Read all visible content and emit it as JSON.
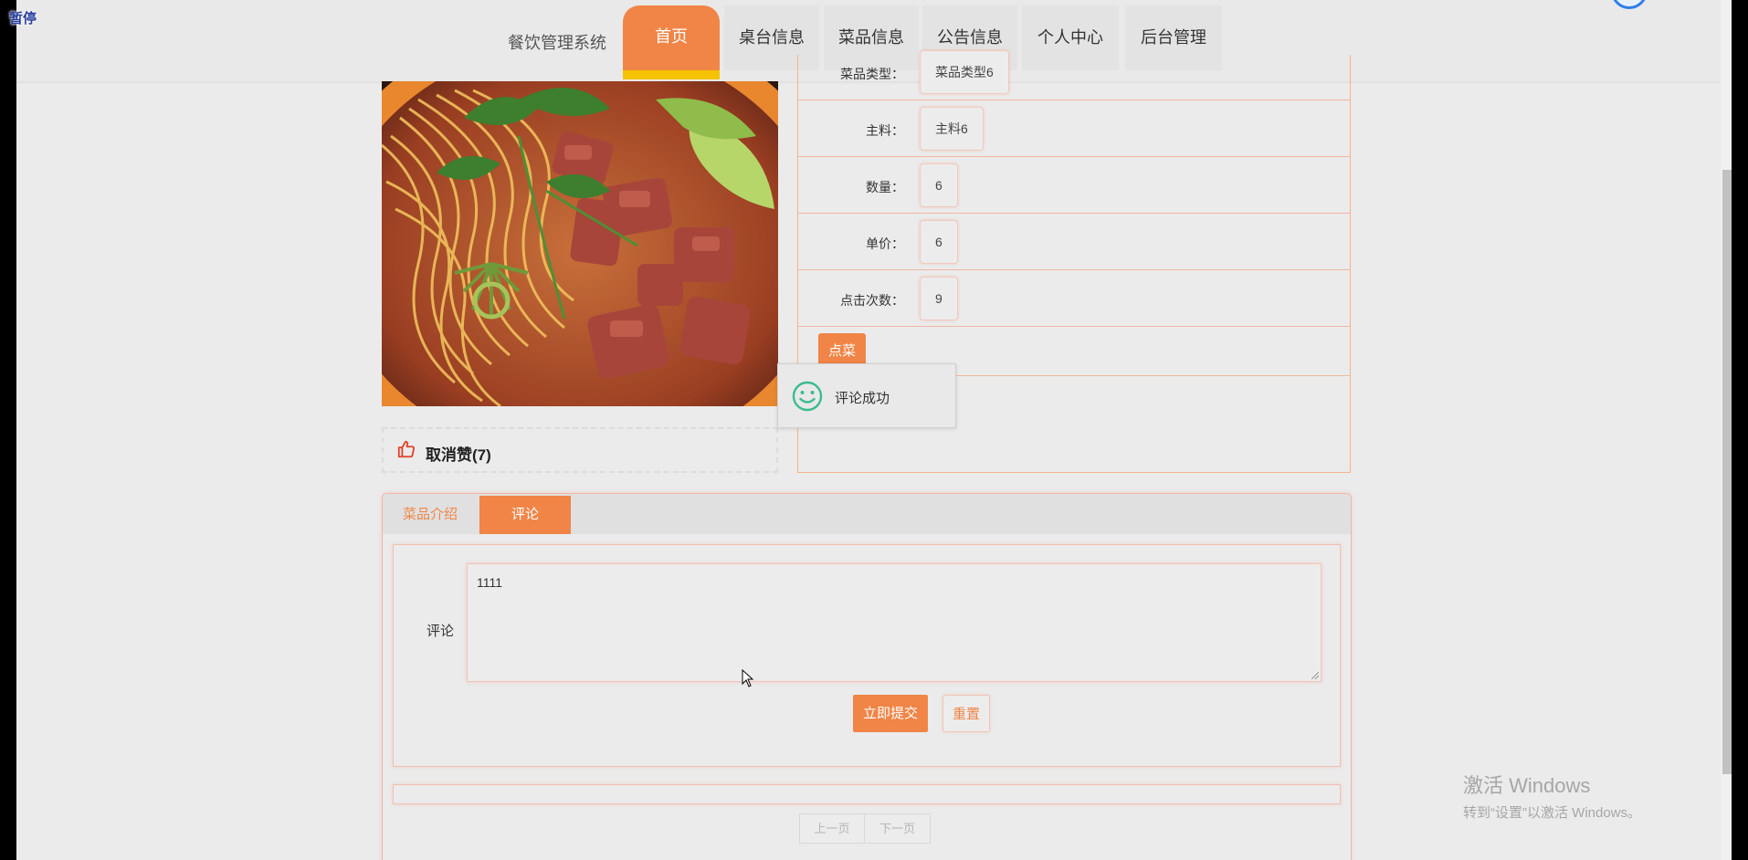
{
  "overlay": {
    "pause_label": "暂停"
  },
  "header": {
    "brand": "餐饮管理系统",
    "nav": [
      "首页",
      "桌台信息",
      "菜品信息",
      "公告信息",
      "个人中心",
      "后台管理"
    ],
    "active_index": 0
  },
  "product": {
    "image_alt": "beef-noodle-soup",
    "like_label": "取消赞(7)"
  },
  "info": {
    "rows": [
      {
        "label": "菜品类型：",
        "value": "菜品类型6"
      },
      {
        "label": "主料：",
        "value": "主料6"
      },
      {
        "label": "数量：",
        "value": "6"
      },
      {
        "label": "单价：",
        "value": "6"
      },
      {
        "label": "点击次数：",
        "value": "9"
      }
    ],
    "order_button": "点菜"
  },
  "toast": {
    "message": "评论成功"
  },
  "tabs": {
    "items": [
      "菜品介绍",
      "评论"
    ],
    "active_index": 1
  },
  "comment_form": {
    "label": "评论",
    "value": "1111",
    "submit_label": "立即提交",
    "reset_label": "重置"
  },
  "pager": {
    "prev": "上一页",
    "next": "下一页"
  },
  "watermark": {
    "line1": "激活 Windows",
    "line2": "转到“设置”以激活 Windows。"
  },
  "colors": {
    "accent": "#f08547",
    "accent_underline": "#f5c300",
    "border": "#f3b48b",
    "success": "#3dbb8f"
  }
}
